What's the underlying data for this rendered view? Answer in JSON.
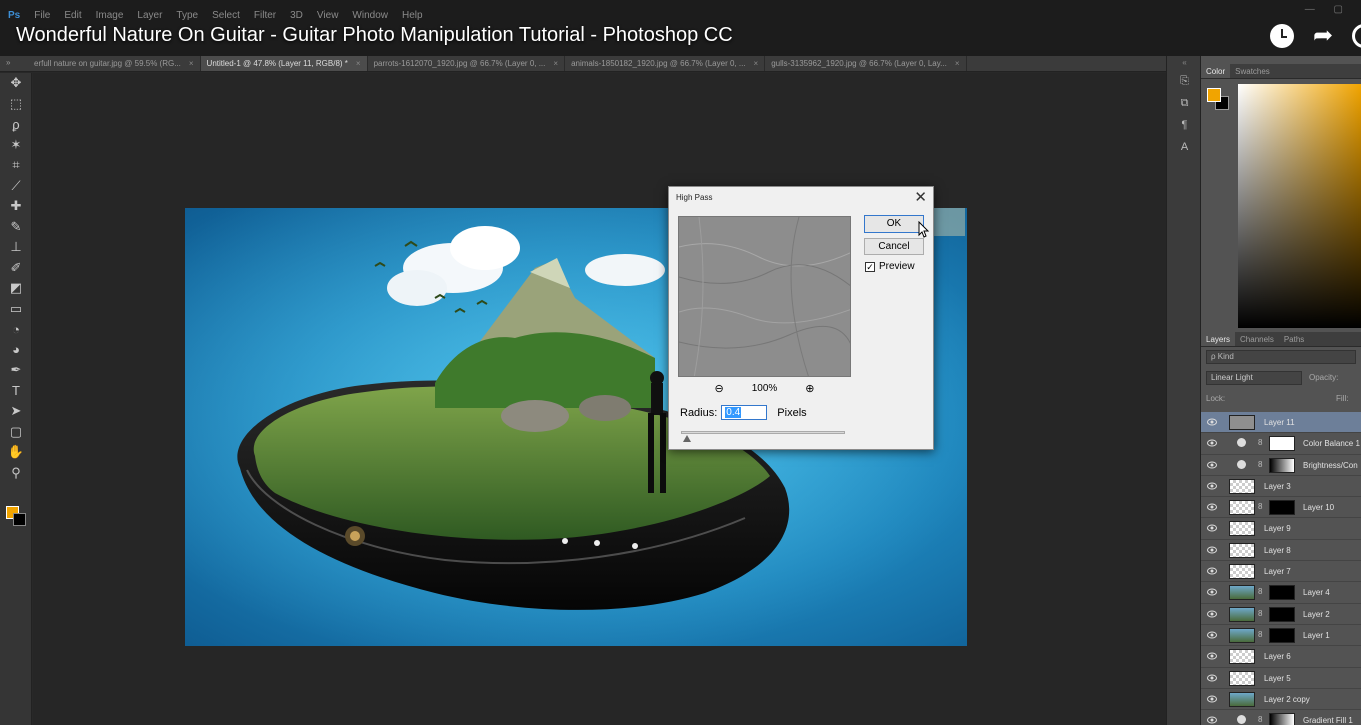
{
  "menu": {
    "logo": "Ps",
    "items": [
      "File",
      "Edit",
      "Image",
      "Layer",
      "Type",
      "Select",
      "Filter",
      "3D",
      "View",
      "Window",
      "Help"
    ]
  },
  "video": {
    "title": "Wonderful Nature On Guitar - Guitar Photo Manipulation Tutorial - Photoshop CC"
  },
  "doc_tabs": [
    {
      "label": "erfull nature on guitar.jpg @ 59.5% (RG...",
      "active": false
    },
    {
      "label": "Untitled-1 @ 47.8% (Layer 11, RGB/8) *",
      "active": true
    },
    {
      "label": "parrots-1612070_1920.jpg @ 66.7% (Layer 0, ...",
      "active": false
    },
    {
      "label": "animals-1850182_1920.jpg @ 66.7% (Layer 0, ...",
      "active": false
    },
    {
      "label": "gulls-3135962_1920.jpg @ 66.7% (Layer 0, Lay...",
      "active": false
    }
  ],
  "colors": {
    "foreground": "#f1a400",
    "background": "#000000",
    "selection": "#6d7f99",
    "ok_border": "#3377cc"
  },
  "high_pass": {
    "title": "High Pass",
    "ok_label": "OK",
    "cancel_label": "Cancel",
    "preview_label": "Preview",
    "preview_checked": true,
    "zoom": "100%",
    "radius_label": "Radius:",
    "radius_value": "0.4",
    "radius_unit": "Pixels",
    "close_glyph": "✕"
  },
  "color_panel": {
    "tabs": [
      "Color",
      "Swatches"
    ]
  },
  "layers_panel": {
    "tabs": [
      "Layers",
      "Channels",
      "Paths"
    ],
    "search_label": "ρ Kind",
    "blend_mode": "Linear Light",
    "opacity_label": "Opacity:",
    "lock_label": "Lock:",
    "fill_label": "Fill:",
    "layers": [
      {
        "name": "Layer 11",
        "selected": true,
        "thumb": "gray",
        "mask": "",
        "adjustment": false
      },
      {
        "name": "Color Balance 1",
        "selected": false,
        "thumb": "",
        "mask": "white",
        "adjustment": true
      },
      {
        "name": "Brightness/Con",
        "selected": false,
        "thumb": "",
        "mask": "gradient",
        "adjustment": true
      },
      {
        "name": "Layer 3",
        "selected": false,
        "thumb": "checker",
        "mask": "",
        "adjustment": false
      },
      {
        "name": "Layer 10",
        "selected": false,
        "thumb": "checker",
        "mask": "black",
        "adjustment": false
      },
      {
        "name": "Layer 9",
        "selected": false,
        "thumb": "checker",
        "mask": "",
        "adjustment": false
      },
      {
        "name": "Layer 8",
        "selected": false,
        "thumb": "checker",
        "mask": "",
        "adjustment": false
      },
      {
        "name": "Layer 7",
        "selected": false,
        "thumb": "checker",
        "mask": "",
        "adjustment": false
      },
      {
        "name": "Layer 4",
        "selected": false,
        "thumb": "photo",
        "mask": "black",
        "adjustment": false
      },
      {
        "name": "Layer 2",
        "selected": false,
        "thumb": "photo",
        "mask": "black",
        "adjustment": false
      },
      {
        "name": "Layer 1",
        "selected": false,
        "thumb": "photo",
        "mask": "black",
        "adjustment": false
      },
      {
        "name": "Layer 6",
        "selected": false,
        "thumb": "checker",
        "mask": "",
        "adjustment": false
      },
      {
        "name": "Layer 5",
        "selected": false,
        "thumb": "checker",
        "mask": "",
        "adjustment": false
      },
      {
        "name": "Layer 2 copy",
        "selected": false,
        "thumb": "photo",
        "mask": "",
        "adjustment": false
      },
      {
        "name": "Gradient Fill 1",
        "selected": false,
        "thumb": "",
        "mask": "gradient",
        "adjustment": true
      }
    ]
  },
  "tools": [
    {
      "icon": "move-icon",
      "glyph": "✥"
    },
    {
      "icon": "marquee-icon",
      "glyph": "⬚"
    },
    {
      "icon": "lasso-icon",
      "glyph": "ϼ"
    },
    {
      "icon": "magic-wand-icon",
      "glyph": "✶"
    },
    {
      "icon": "crop-icon",
      "glyph": "⌗"
    },
    {
      "icon": "eyedropper-icon",
      "glyph": "⟋"
    },
    {
      "icon": "healing-brush-icon",
      "glyph": "✚"
    },
    {
      "icon": "brush-icon",
      "glyph": "✎"
    },
    {
      "icon": "stamp-icon",
      "glyph": "⊥"
    },
    {
      "icon": "history-brush-icon",
      "glyph": "✐"
    },
    {
      "icon": "eraser-icon",
      "glyph": "◩"
    },
    {
      "icon": "gradient-icon",
      "glyph": "▭"
    },
    {
      "icon": "blur-icon",
      "glyph": "◔"
    },
    {
      "icon": "dodge-icon",
      "glyph": "◕"
    },
    {
      "icon": "pen-icon",
      "glyph": "✒"
    },
    {
      "icon": "type-icon",
      "glyph": "T"
    },
    {
      "icon": "path-select-icon",
      "glyph": "➤"
    },
    {
      "icon": "shape-icon",
      "glyph": "▢"
    },
    {
      "icon": "hand-icon",
      "glyph": "✋"
    },
    {
      "icon": "zoom-icon",
      "glyph": "⚲"
    }
  ],
  "side_icons": [
    {
      "icon": "history-panel-icon",
      "glyph": "⎘"
    },
    {
      "icon": "properties-panel-icon",
      "glyph": "⧉"
    },
    {
      "icon": "character-panel-icon",
      "glyph": "¶"
    },
    {
      "icon": "paragraph-panel-icon",
      "glyph": "A"
    }
  ]
}
